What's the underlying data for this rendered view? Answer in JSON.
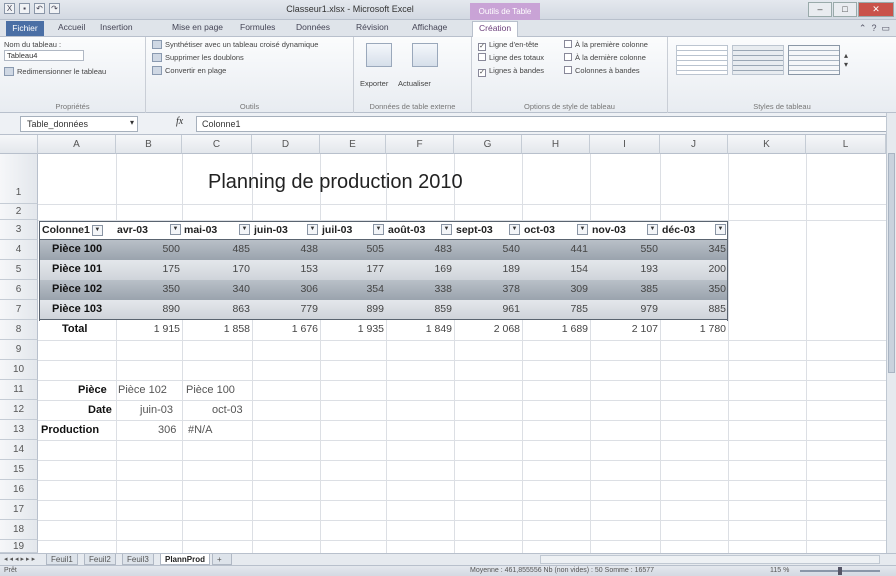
{
  "window": {
    "title": "Classeur1.xlsx - Microsoft Excel",
    "context_tab": "Outils de Table"
  },
  "tabs": [
    "Fichier",
    "Accueil",
    "Insertion",
    "Mise en page",
    "Formules",
    "Données",
    "Révision",
    "Affichage",
    "Création"
  ],
  "ribbon": {
    "props": {
      "name_label": "Nom du tableau :",
      "name_value": "Tableau4",
      "resize": "Redimensionner le tableau",
      "label": "Propriétés"
    },
    "tools": {
      "pivot": "Synthétiser avec un tableau croisé dynamique",
      "remove_dup": "Supprimer les doublons",
      "convert": "Convertir en plage",
      "label": "Outils"
    },
    "ext": {
      "export": "Exporter",
      "refresh": "Actualiser",
      "label": "Données de table externe"
    },
    "style_opts": {
      "header_row": "Ligne d'en-tête",
      "total_row": "Ligne des totaux",
      "banded_rows": "Lignes à bandes",
      "first_col": "À la première colonne",
      "last_col": "À la dernière colonne",
      "banded_cols": "Colonnes à bandes",
      "label": "Options de style de tableau"
    },
    "styles": {
      "label": "Styles de tableau"
    }
  },
  "formula_bar": {
    "name_box": "Table_données",
    "fx": "fx",
    "formula": "Colonne1"
  },
  "columns": [
    "A",
    "B",
    "C",
    "D",
    "E",
    "F",
    "G",
    "H",
    "I",
    "J",
    "K",
    "L"
  ],
  "rows": [
    "1",
    "2",
    "3",
    "4",
    "5",
    "6",
    "7",
    "8",
    "9",
    "10",
    "11",
    "12",
    "13",
    "14",
    "15",
    "16",
    "17",
    "18",
    "19"
  ],
  "sheet": {
    "title": "Planning de production 2010",
    "headers": [
      "Colonne1",
      "avr-03",
      "mai-03",
      "juin-03",
      "juil-03",
      "août-03",
      "sept-03",
      "oct-03",
      "nov-03",
      "déc-03"
    ],
    "data": [
      {
        "label": "Pièce 100",
        "values": [
          "500",
          "485",
          "438",
          "505",
          "483",
          "540",
          "441",
          "550",
          "345"
        ]
      },
      {
        "label": "Pièce 101",
        "values": [
          "175",
          "170",
          "153",
          "177",
          "169",
          "189",
          "154",
          "193",
          "200"
        ]
      },
      {
        "label": "Pièce 102",
        "values": [
          "350",
          "340",
          "306",
          "354",
          "338",
          "378",
          "309",
          "385",
          "350"
        ]
      },
      {
        "label": "Pièce 103",
        "values": [
          "890",
          "863",
          "779",
          "899",
          "859",
          "961",
          "785",
          "979",
          "885"
        ]
      }
    ],
    "total": {
      "label": "Total",
      "values": [
        "1 915",
        "1 858",
        "1 676",
        "1 935",
        "1 849",
        "2 068",
        "1 689",
        "2 107",
        "1 780"
      ]
    },
    "lookup": {
      "piece_label": "Pièce",
      "piece_1": "Pièce 102",
      "piece_2": "Pièce 100",
      "date_label": "Date",
      "date_1": "juin-03",
      "date_2": "oct-03",
      "prod_label": "Production",
      "prod_1": "306",
      "prod_2": "#N/A"
    }
  },
  "sheet_tabs": [
    "Feuil1",
    "Feuil2",
    "Feuil3",
    "PlannProd"
  ],
  "status": {
    "ready": "Prêt",
    "stats": "Moyenne : 461,855556    Nb (non vides) : 50    Somme : 16577",
    "zoom": "115 %"
  },
  "colors": {
    "band_dark": "#9aa3ad",
    "band_light": "#d0d5db",
    "file_tab": "#4a6fa5",
    "context": "#c9a3d6"
  }
}
